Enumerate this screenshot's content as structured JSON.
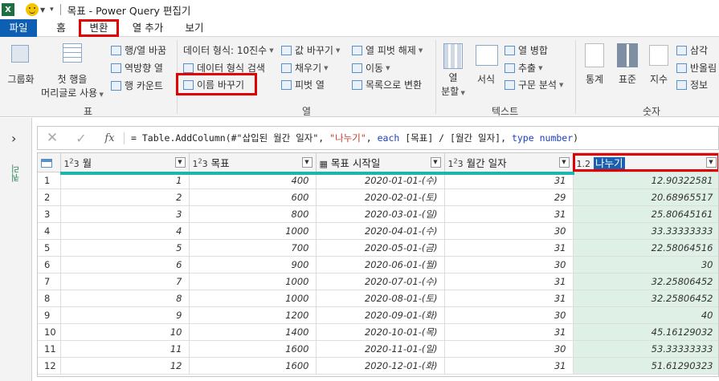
{
  "window": {
    "title": "목표 - Power Query 편집기",
    "app_icon": "excel-icon"
  },
  "tabs": [
    {
      "label": "파일",
      "active": false
    },
    {
      "label": "홈",
      "active": false
    },
    {
      "label": "변환",
      "active": true
    },
    {
      "label": "열 추가",
      "active": false
    },
    {
      "label": "보기",
      "active": false
    }
  ],
  "ribbon": {
    "table_group": {
      "label": "표",
      "group_by": "그룹화",
      "first_row_headers": "첫 행을",
      "first_row_headers2": "머리글로 사용",
      "transpose": "행/열 바꿈",
      "reverse_rows": "역방향 열",
      "count_rows": "행 카운트"
    },
    "any_column_group": {
      "label": "열",
      "data_type": "데이터 형식: 10진수",
      "detect_type": "데이터 형식 검색",
      "rename": "이름 바꾸기",
      "replace_values": "값 바꾸기",
      "fill": "채우기",
      "pivot": "피벗 열",
      "unpivot": "열 피벗 해제",
      "move": "이동",
      "to_list": "목록으로 변환"
    },
    "text_group": {
      "label": "텍스트",
      "split": "열",
      "split2": "분할",
      "format": "서식",
      "merge": "열 병합",
      "extract": "추출",
      "parse": "구문 분석"
    },
    "number_group": {
      "label": "숫자",
      "stats": "통계",
      "standard": "표준",
      "scientific": "지수",
      "trig": "삼각",
      "rounding": "반올림",
      "info": "정보"
    }
  },
  "side_panel": {
    "label": "쿼리"
  },
  "formula_bar": {
    "fx": "fx",
    "p1": "= Table.AddColumn(#\"삽입된 월간 일자\", ",
    "p2": "\"나누기\"",
    "p3": ", ",
    "p4": "each",
    "p5": " [목표] / [월간 일자], ",
    "p6": "type",
    "p7": " ",
    "p8": "number",
    "p9": ")"
  },
  "table": {
    "columns": [
      {
        "type": "123",
        "name": "월"
      },
      {
        "type": "123",
        "name": "목표"
      },
      {
        "type": "date",
        "name": "목표 시작일"
      },
      {
        "type": "123",
        "name": "월간 일자"
      },
      {
        "type": "1.2",
        "name": "나누기"
      }
    ],
    "rows": [
      {
        "n": "1",
        "month": "1",
        "goal": "400",
        "start": "2020-01-01-(수)",
        "days": "31",
        "div": "12.90322581"
      },
      {
        "n": "2",
        "month": "2",
        "goal": "600",
        "start": "2020-02-01-(토)",
        "days": "29",
        "div": "20.68965517"
      },
      {
        "n": "3",
        "month": "3",
        "goal": "800",
        "start": "2020-03-01-(일)",
        "days": "31",
        "div": "25.80645161"
      },
      {
        "n": "4",
        "month": "4",
        "goal": "1000",
        "start": "2020-04-01-(수)",
        "days": "30",
        "div": "33.33333333"
      },
      {
        "n": "5",
        "month": "5",
        "goal": "700",
        "start": "2020-05-01-(금)",
        "days": "31",
        "div": "22.58064516"
      },
      {
        "n": "6",
        "month": "6",
        "goal": "900",
        "start": "2020-06-01-(월)",
        "days": "30",
        "div": "30"
      },
      {
        "n": "7",
        "month": "7",
        "goal": "1000",
        "start": "2020-07-01-(수)",
        "days": "31",
        "div": "32.25806452"
      },
      {
        "n": "8",
        "month": "8",
        "goal": "1000",
        "start": "2020-08-01-(토)",
        "days": "31",
        "div": "32.25806452"
      },
      {
        "n": "9",
        "month": "9",
        "goal": "1200",
        "start": "2020-09-01-(화)",
        "days": "30",
        "div": "40"
      },
      {
        "n": "10",
        "month": "10",
        "goal": "1400",
        "start": "2020-10-01-(목)",
        "days": "31",
        "div": "45.16129032"
      },
      {
        "n": "11",
        "month": "11",
        "goal": "1600",
        "start": "2020-11-01-(일)",
        "days": "30",
        "div": "53.33333333"
      },
      {
        "n": "12",
        "month": "12",
        "goal": "1600",
        "start": "2020-12-01-(화)",
        "days": "31",
        "div": "51.61290323"
      }
    ]
  }
}
